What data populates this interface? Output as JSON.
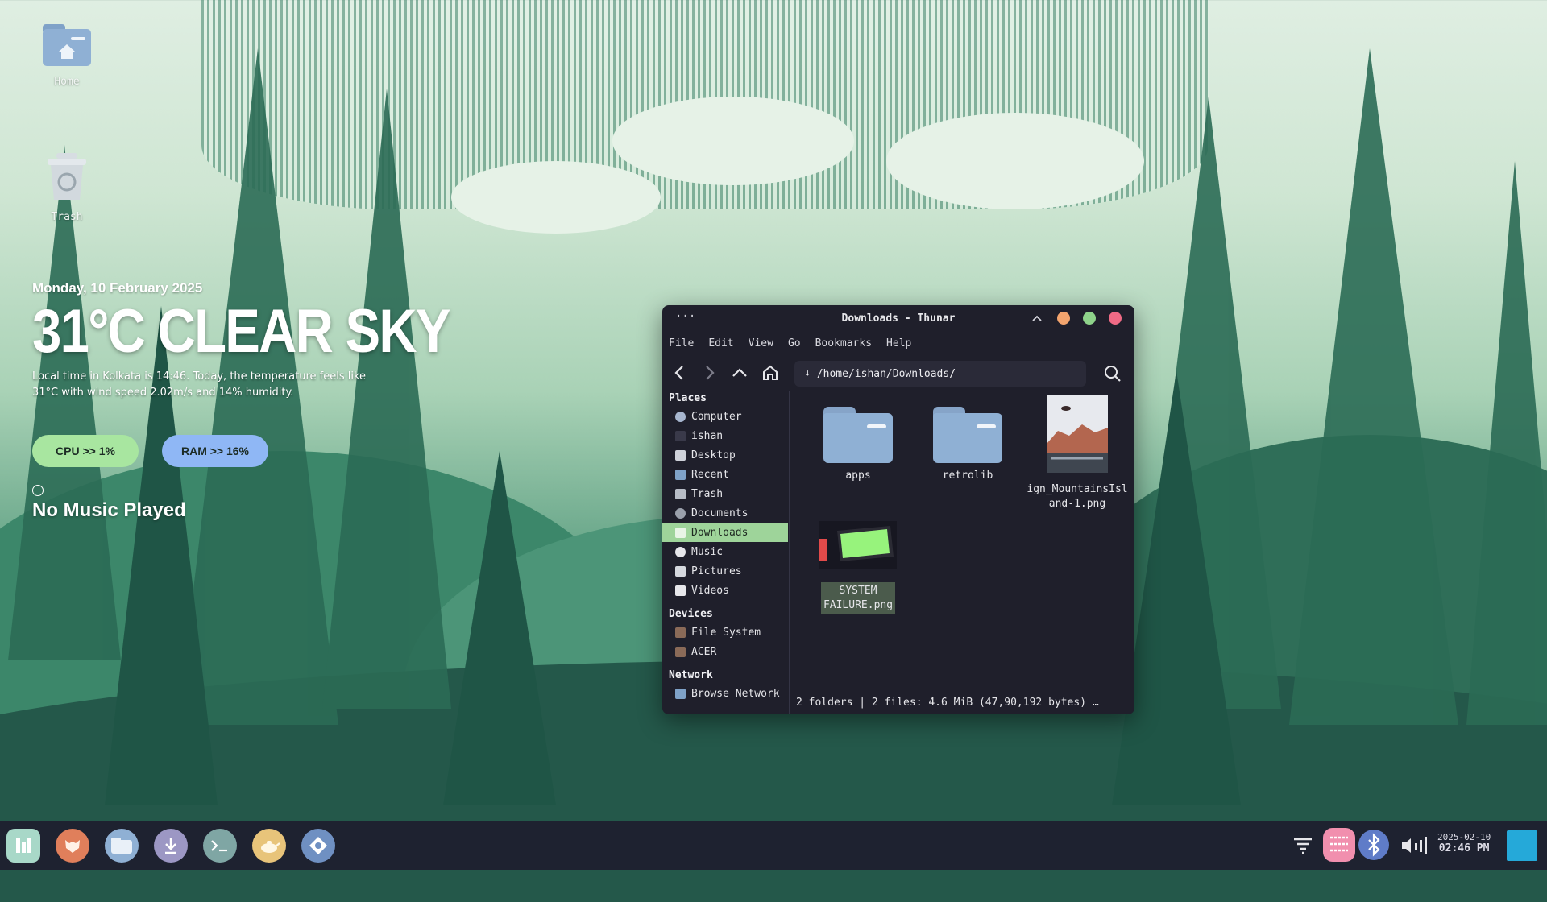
{
  "desktop": {
    "icons": [
      {
        "label": "Home"
      },
      {
        "label": "Trash"
      }
    ]
  },
  "widget": {
    "date": "Monday, 10 February 2025",
    "weather": "31°C CLEAR SKY",
    "description": "Local time in Kolkata is 14:46. Today, the temperature feels like 31°C with wind speed 2.02m/s and 14% humidity.",
    "cpu": "CPU >> 1%",
    "ram": "RAM >> 16%",
    "music": "No Music Played"
  },
  "window": {
    "title": "Downloads - Thunar",
    "menu": [
      "File",
      "Edit",
      "View",
      "Go",
      "Bookmarks",
      "Help"
    ],
    "path": "/home/ishan/Downloads/",
    "sidebar": {
      "places_header": "Places",
      "places": [
        "Computer",
        "ishan",
        "Desktop",
        "Recent",
        "Trash",
        "Documents",
        "Downloads",
        "Music",
        "Pictures",
        "Videos"
      ],
      "devices_header": "Devices",
      "devices": [
        "File System",
        "ACER"
      ],
      "network_header": "Network",
      "network": [
        "Browse Network"
      ]
    },
    "files": [
      {
        "name": "apps",
        "kind": "folder"
      },
      {
        "name": "retrolib",
        "kind": "folder"
      },
      {
        "name": "ign_MountainsIsland-1.png",
        "kind": "image"
      },
      {
        "name": "SYSTEM FAILURE.png",
        "kind": "image"
      }
    ],
    "status": "2 folders  |  2 files: 4.6 MiB (47,90,192 bytes)  …"
  },
  "taskbar": {
    "date": "2025-02-10",
    "time": "02:46 PM"
  },
  "colors": {
    "accent_green": "#9ed49a",
    "cpu_pill": "#a8e6a0",
    "ram_pill": "#8fb7f5",
    "close": "#f06a85",
    "maximize": "#8ed28a",
    "minimize": "#f3a46e"
  }
}
